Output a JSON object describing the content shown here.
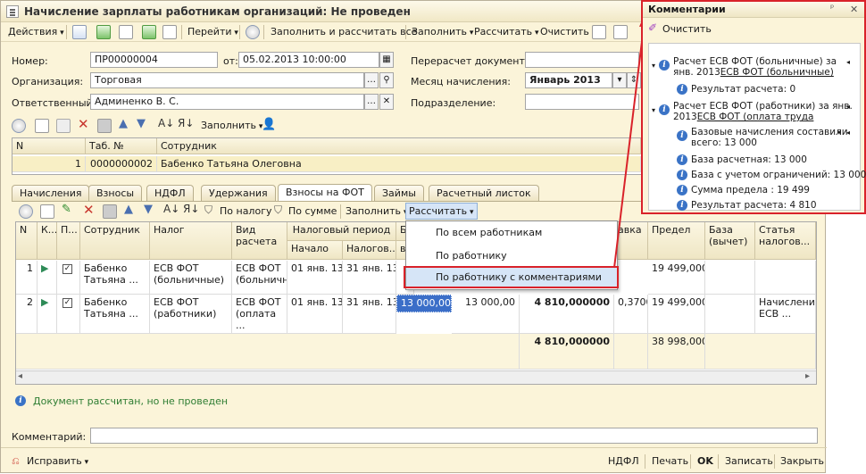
{
  "window": {
    "title": "Начисление зарплаты работникам организаций: Не проведен"
  },
  "toolbar": {
    "actions": "Действия",
    "goto": "Перейти",
    "fill_calc_all": "Заполнить и рассчитать все",
    "fill": "Заполнить",
    "calc": "Рассчитать",
    "clear": "Очистить"
  },
  "form": {
    "number_label": "Номер:",
    "number_value": "ПР00000004",
    "from_label": "от:",
    "date_value": "05.02.2013 10:00:00",
    "org_label": "Организация:",
    "org_value": "Торговая",
    "resp_label": "Ответственный:",
    "resp_value": "Админенко В. С.",
    "recalc_label": "Перерасчет документа:",
    "month_label": "Месяц начисления:",
    "month_value": "Январь 2013",
    "dept_label": "Подразделение:"
  },
  "subtoolbar1": {
    "fill": "Заполнить"
  },
  "emp_table": {
    "headers": [
      "N",
      "Таб. №",
      "Сотрудник"
    ],
    "rows": [
      {
        "n": "1",
        "tab": "0000000002",
        "name": "Бабенко Татьяна Олеговна"
      }
    ]
  },
  "tabs": [
    "Начисления",
    "Взносы",
    "НДФЛ",
    "Удержания",
    "Взносы на ФОТ",
    "Займы",
    "Расчетный листок"
  ],
  "subtoolbar2": {
    "by_tax": "По налогу",
    "by_sum": "По сумме",
    "fill": "Заполнить",
    "calc": "Рассчитать"
  },
  "dropdown": {
    "items": [
      "По всем работникам",
      "По работнику",
      "По работнику с комментариями"
    ]
  },
  "main_table": {
    "headers": {
      "n": "N",
      "k": "К...",
      "p": "П...",
      "employee": "Сотрудник",
      "tax": "Налог",
      "calc_type": "Вид расчета",
      "period": "Налоговый период",
      "start": "Начало",
      "end": "Налогов...",
      "b": "Б",
      "v": "в",
      "rate": "авка",
      "limit": "Предел",
      "base_deduct": "База (вычет)",
      "article": "Статья налогов..."
    },
    "rows": [
      {
        "n": "1",
        "employee": "Бабенко Татьяна ...",
        "tax": "ЕСВ ФОТ (больничные)",
        "calc_type": "ЕСВ ФОТ (больничн...",
        "start": "01 янв. 13",
        "end": "31 янв. 13",
        "limit": "19 499,000"
      },
      {
        "n": "2",
        "employee": "Бабенко Татьяна ...",
        "tax": "ЕСВ ФОТ (работники)",
        "calc_type": "ЕСВ ФОТ (оплата ...",
        "start": "01 янв. 13",
        "end": "31 янв. 13",
        "base": "13 000,00",
        "base2": "13 000,00",
        "result": "4 810,000000",
        "rate": "0,3700",
        "limit": "19 499,000",
        "article": "Начисление ЕСВ ..."
      }
    ],
    "totals": {
      "result": "4 810,000000",
      "limit": "38 998,000"
    }
  },
  "status": {
    "message": "Документ рассчитан, но не проведен"
  },
  "comment": {
    "label": "Комментарий:",
    "value": ""
  },
  "bottom": {
    "fix": "Исправить",
    "ndfl": "НДФЛ",
    "print": "Печать",
    "ok": "OK",
    "save": "Записать",
    "close": "Закрыть"
  },
  "comments_panel": {
    "title": "Комментарии",
    "clear": "Очистить",
    "lines": [
      "Расчет ЕСВ ФОТ (больничные) за",
      "янв. 2013",
      "ЕСВ ФОТ (больничные)",
      "Результат расчета: 0",
      "Расчет ЕСВ ФОТ (работники) за янв.",
      "2013",
      "ЕСВ ФОТ (оплата труда",
      "Базовые начисления составили",
      "всего: 13 000",
      "База расчетная: 13 000",
      "База с учетом ограничений: 13 000",
      "Сумма предела : 19 499",
      "Результат расчета: 4 810"
    ]
  },
  "colors": {
    "highlight_red": "#d9222a",
    "window_bg": "#fbf4d9",
    "selection": "#d6e5f7"
  }
}
